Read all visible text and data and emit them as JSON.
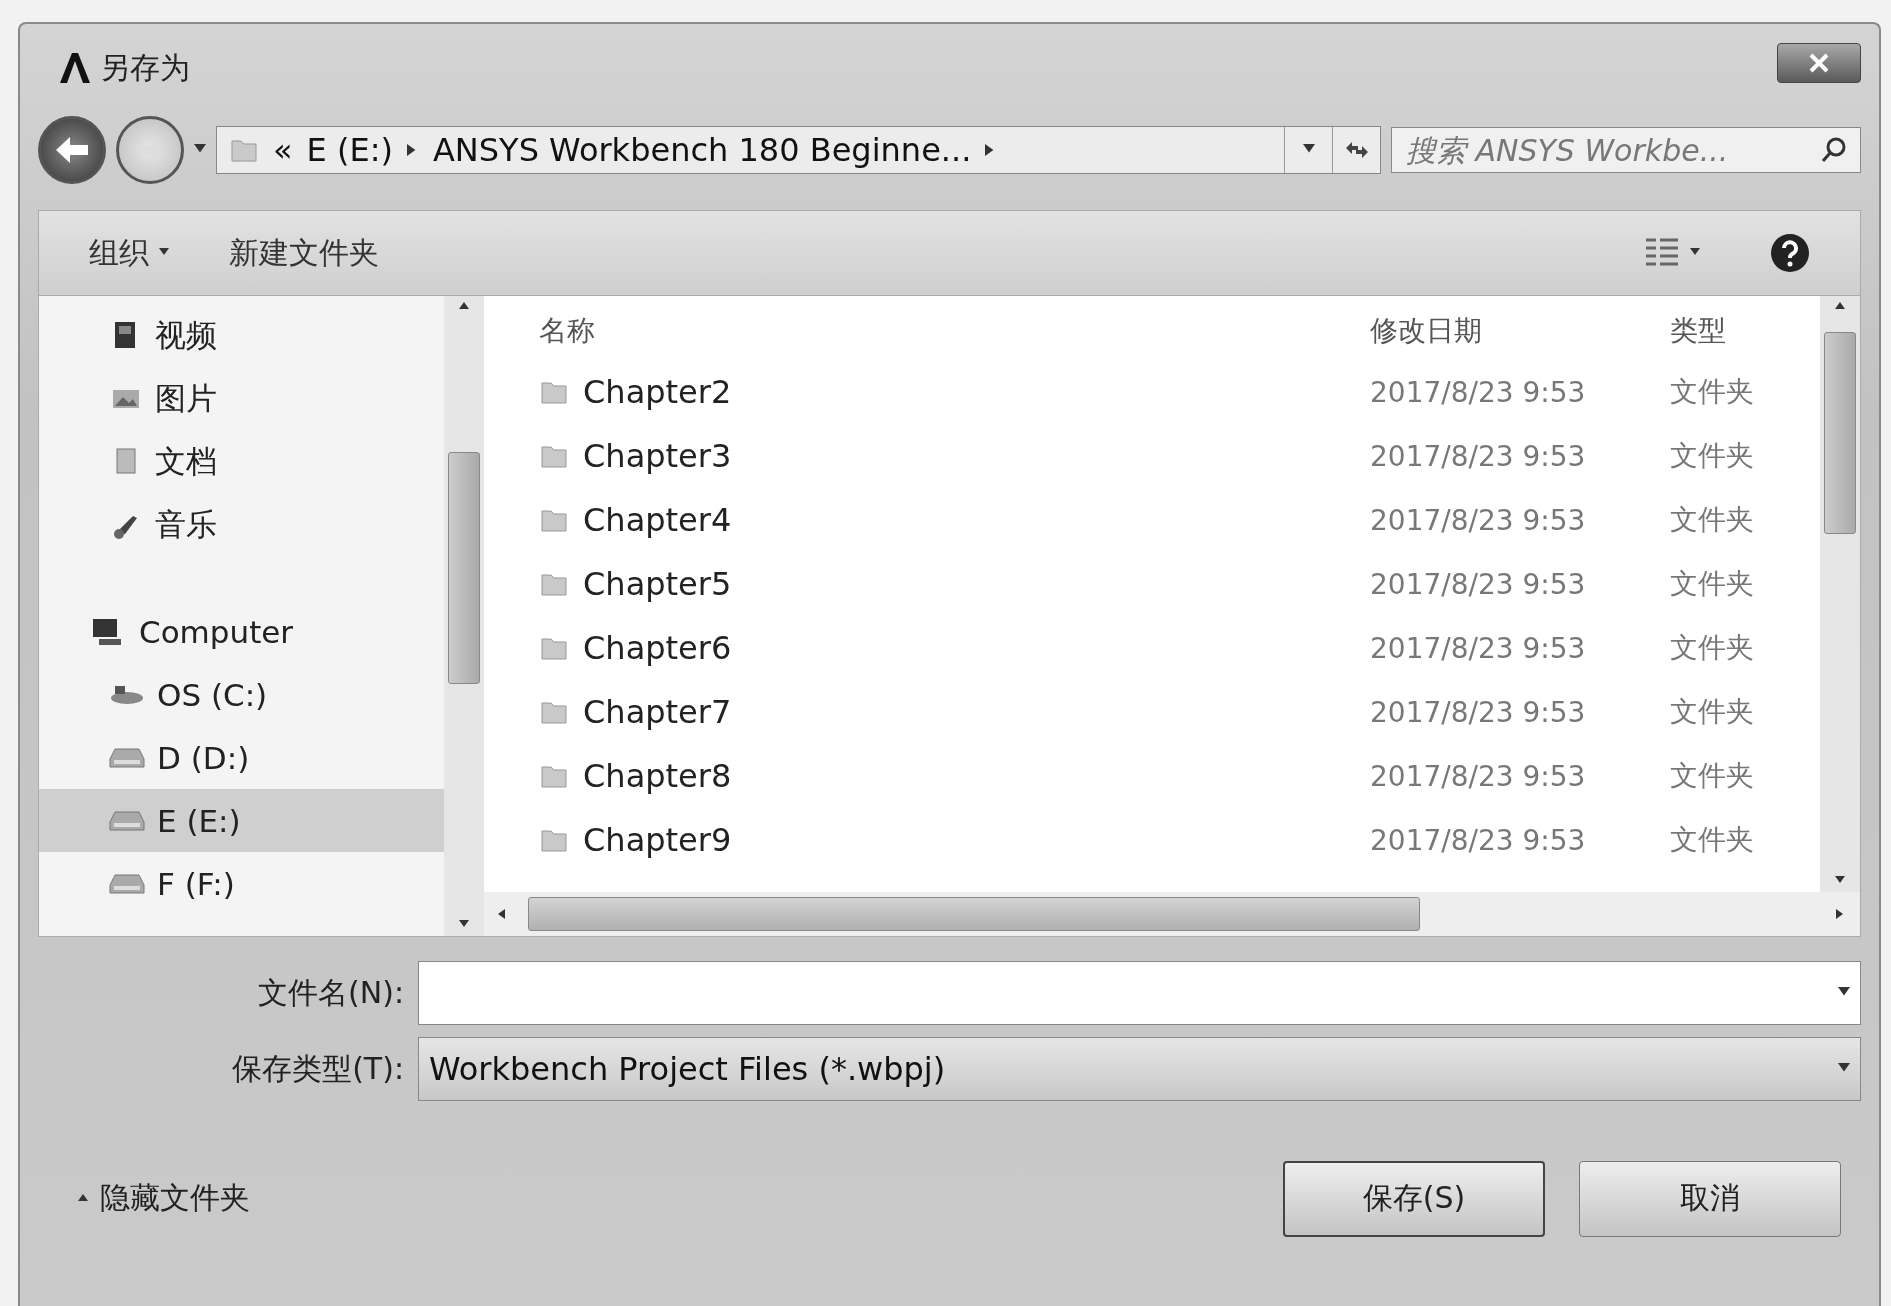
{
  "window": {
    "title": "另存为"
  },
  "address": {
    "overflow": "«",
    "segments": [
      "E (E:)",
      "ANSYS Workbench 180 Beginne..."
    ]
  },
  "search": {
    "placeholder": "搜索 ANSYS Workbe..."
  },
  "toolbar": {
    "organize": "组织",
    "new_folder": "新建文件夹"
  },
  "sidebar": {
    "items": [
      {
        "label": "视频",
        "kind": "video",
        "selected": false
      },
      {
        "label": "图片",
        "kind": "picture",
        "selected": false
      },
      {
        "label": "文档",
        "kind": "document",
        "selected": false
      },
      {
        "label": "音乐",
        "kind": "music",
        "selected": false
      },
      {
        "label": "Computer",
        "kind": "computer",
        "selected": false,
        "children": [
          {
            "label": "OS (C:)",
            "kind": "system-drive",
            "selected": false
          },
          {
            "label": "D (D:)",
            "kind": "drive",
            "selected": false
          },
          {
            "label": "E (E:)",
            "kind": "drive",
            "selected": true
          },
          {
            "label": "F (F:)",
            "kind": "drive",
            "selected": false
          }
        ]
      }
    ]
  },
  "table": {
    "columns": [
      "名称",
      "修改日期",
      "类型"
    ],
    "rows": [
      {
        "name": "Chapter2",
        "date": "2017/8/23 9:53",
        "type": "文件夹"
      },
      {
        "name": "Chapter3",
        "date": "2017/8/23 9:53",
        "type": "文件夹"
      },
      {
        "name": "Chapter4",
        "date": "2017/8/23 9:53",
        "type": "文件夹"
      },
      {
        "name": "Chapter5",
        "date": "2017/8/23 9:53",
        "type": "文件夹"
      },
      {
        "name": "Chapter6",
        "date": "2017/8/23 9:53",
        "type": "文件夹"
      },
      {
        "name": "Chapter7",
        "date": "2017/8/23 9:53",
        "type": "文件夹"
      },
      {
        "name": "Chapter8",
        "date": "2017/8/23 9:53",
        "type": "文件夹"
      },
      {
        "name": "Chapter9",
        "date": "2017/8/23 9:53",
        "type": "文件夹"
      }
    ]
  },
  "form": {
    "filename_label": "文件名(N):",
    "filetype_label": "保存类型(T):",
    "filetype_value": "Workbench Project Files (*.wbpj)"
  },
  "hide_folders": "隐藏文件夹",
  "buttons": [
    "保存(S)",
    "取消"
  ]
}
